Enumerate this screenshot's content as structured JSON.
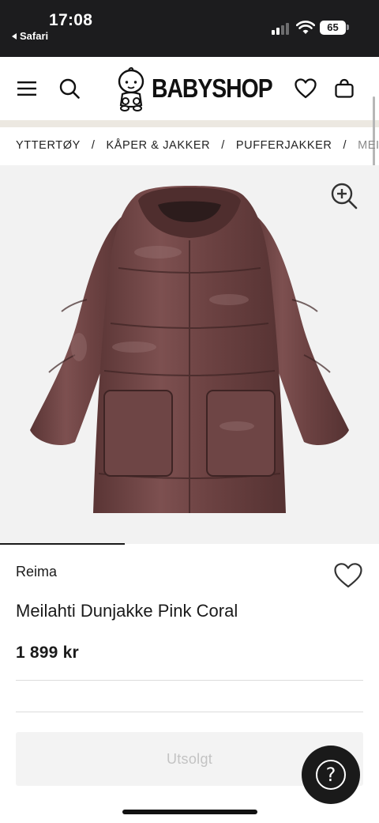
{
  "status_bar": {
    "time": "17:08",
    "back_app": "Safari",
    "battery": "65"
  },
  "header": {
    "logo_text": "BABYSHOP",
    "icons": [
      "menu-icon",
      "search-icon",
      "heart-icon",
      "shopping-bag-icon"
    ]
  },
  "breadcrumbs": [
    {
      "label": "YTTERTØY"
    },
    {
      "label": "KÅPER & JAKKER"
    },
    {
      "label": "PUFFERJAKKER"
    },
    {
      "label": "MEILAHTI"
    }
  ],
  "product": {
    "brand": "Reima",
    "name": "Meilahti Dunjakke Pink Coral",
    "price": "1 899 kr",
    "image_progress": 0.33,
    "jacket_color": "#6b4040"
  },
  "actions": {
    "soldout_label": "Utsolgt",
    "help_label": "?"
  },
  "colors": {
    "status_bar_bg": "#1c1c1e",
    "accent_dark": "#1a1a1a",
    "header_band": "#ece8e1"
  }
}
